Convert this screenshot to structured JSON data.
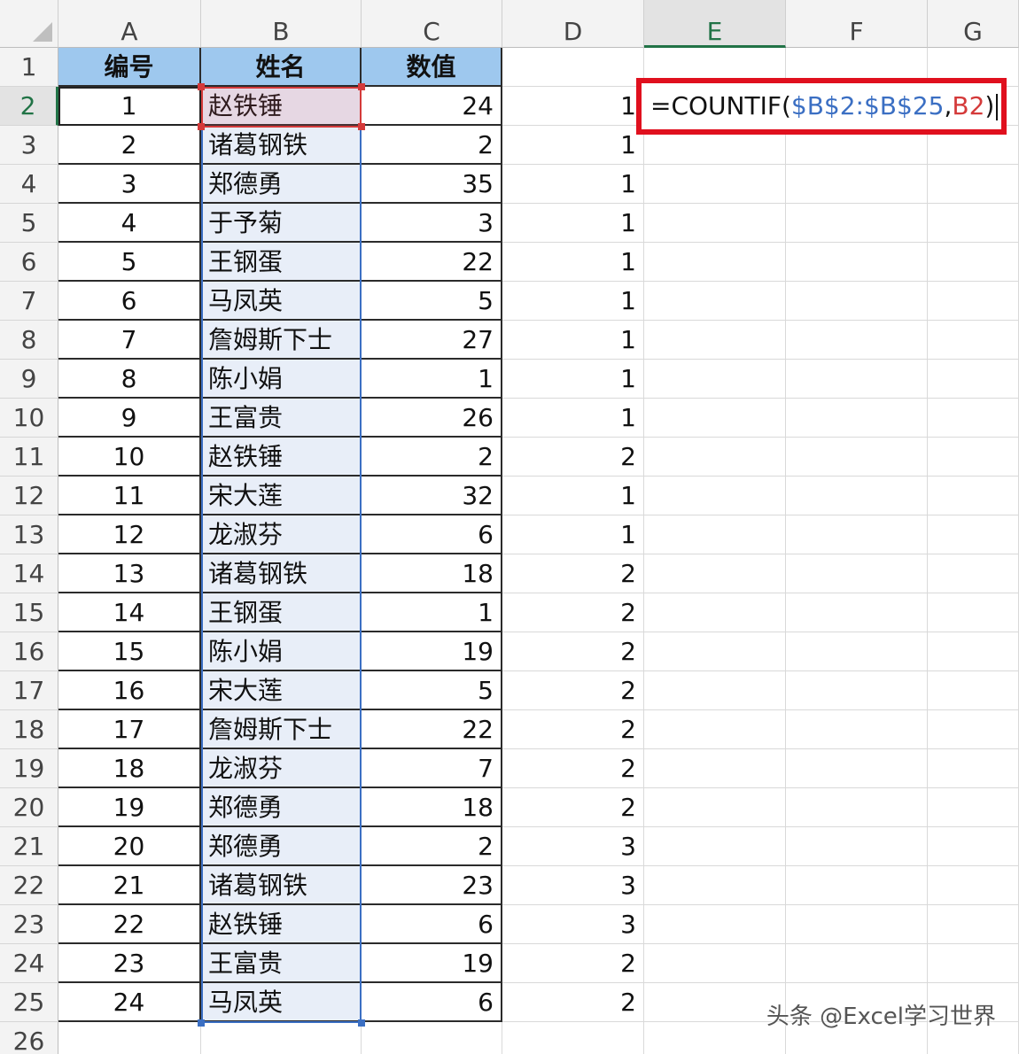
{
  "columns": [
    "A",
    "B",
    "C",
    "D",
    "E",
    "F",
    "G"
  ],
  "active_column": "E",
  "active_row": 2,
  "rows_shown": [
    1,
    2,
    3,
    4,
    5,
    6,
    7,
    8,
    9,
    10,
    11,
    12,
    13,
    14,
    15,
    16,
    17,
    18,
    19,
    20,
    21,
    22,
    23,
    24,
    25,
    26
  ],
  "table": {
    "headers": [
      "编号",
      "姓名",
      "数值"
    ],
    "rows": [
      {
        "id": "1",
        "name": "赵铁锤",
        "value": "24",
        "count": "1"
      },
      {
        "id": "2",
        "name": "诸葛钢铁",
        "value": "2",
        "count": "1"
      },
      {
        "id": "3",
        "name": "郑德勇",
        "value": "35",
        "count": "1"
      },
      {
        "id": "4",
        "name": "于予菊",
        "value": "3",
        "count": "1"
      },
      {
        "id": "5",
        "name": "王钢蛋",
        "value": "22",
        "count": "1"
      },
      {
        "id": "6",
        "name": "马凤英",
        "value": "5",
        "count": "1"
      },
      {
        "id": "7",
        "name": "詹姆斯下士",
        "value": "27",
        "count": "1"
      },
      {
        "id": "8",
        "name": "陈小娟",
        "value": "1",
        "count": "1"
      },
      {
        "id": "9",
        "name": "王富贵",
        "value": "26",
        "count": "1"
      },
      {
        "id": "10",
        "name": "赵铁锤",
        "value": "2",
        "count": "2"
      },
      {
        "id": "11",
        "name": "宋大莲",
        "value": "32",
        "count": "1"
      },
      {
        "id": "12",
        "name": "龙淑芬",
        "value": "6",
        "count": "1"
      },
      {
        "id": "13",
        "name": "诸葛钢铁",
        "value": "18",
        "count": "2"
      },
      {
        "id": "14",
        "name": "王钢蛋",
        "value": "1",
        "count": "2"
      },
      {
        "id": "15",
        "name": "陈小娟",
        "value": "19",
        "count": "2"
      },
      {
        "id": "16",
        "name": "宋大莲",
        "value": "5",
        "count": "2"
      },
      {
        "id": "17",
        "name": "詹姆斯下士",
        "value": "22",
        "count": "2"
      },
      {
        "id": "18",
        "name": "龙淑芬",
        "value": "7",
        "count": "2"
      },
      {
        "id": "19",
        "name": "郑德勇",
        "value": "18",
        "count": "2"
      },
      {
        "id": "20",
        "name": "郑德勇",
        "value": "2",
        "count": "3"
      },
      {
        "id": "21",
        "name": "诸葛钢铁",
        "value": "23",
        "count": "3"
      },
      {
        "id": "22",
        "name": "赵铁锤",
        "value": "6",
        "count": "3"
      },
      {
        "id": "23",
        "name": "王富贵",
        "value": "19",
        "count": "2"
      },
      {
        "id": "24",
        "name": "马凤英",
        "value": "6",
        "count": "2"
      }
    ]
  },
  "formula": {
    "prefix": "=COUNTIF(",
    "range": "$B$2:$B$25",
    "sep": ",",
    "ref": "B2",
    "suffix": ")"
  },
  "colors": {
    "header_fill": "#9ec8ee",
    "range_blue": "#3b6fc3",
    "ref_red": "#d43a3a",
    "highlight_border": "#e0101e",
    "excel_green": "#217346"
  },
  "watermark": "头条 @Excel学习世界"
}
